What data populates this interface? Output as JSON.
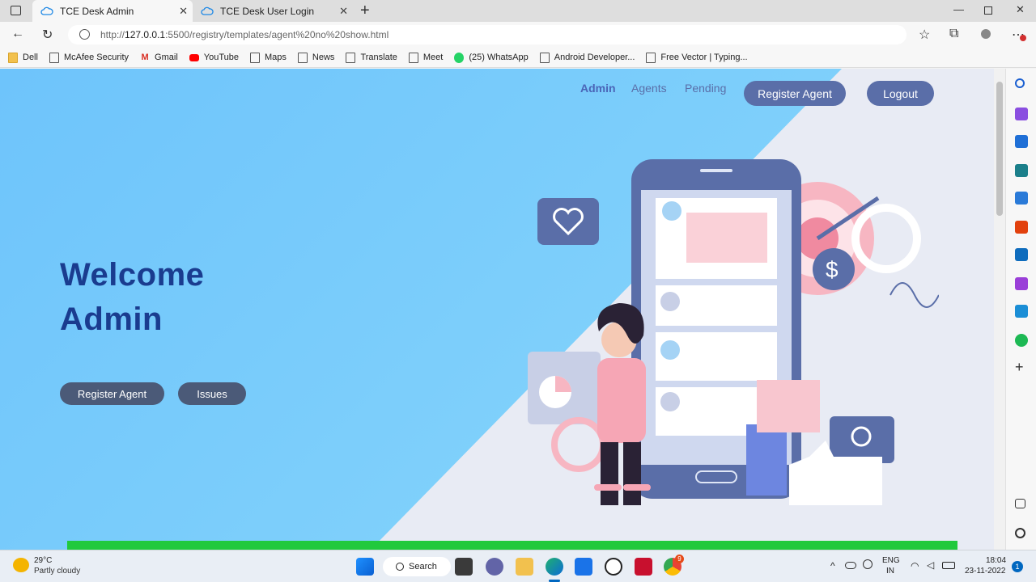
{
  "browser": {
    "tabs": [
      {
        "title": "TCE Desk Admin",
        "active": true
      },
      {
        "title": "TCE Desk User Login",
        "active": false
      }
    ],
    "url_prefix": "http://",
    "url_host": "127.0.0.1",
    "url_rest": ":5500/registry/templates/agent%20no%20show.html",
    "bookmarks": [
      {
        "label": "Dell",
        "icon": "folder-icon"
      },
      {
        "label": "McAfee Security",
        "icon": "page-icon"
      },
      {
        "label": "Gmail",
        "icon": "gmail-icon"
      },
      {
        "label": "YouTube",
        "icon": "youtube-icon"
      },
      {
        "label": "Maps",
        "icon": "page-icon"
      },
      {
        "label": "News",
        "icon": "page-icon"
      },
      {
        "label": "Translate",
        "icon": "page-icon"
      },
      {
        "label": "Meet",
        "icon": "page-icon"
      },
      {
        "label": "(25) WhatsApp",
        "icon": "whatsapp-icon"
      },
      {
        "label": "Android Developer...",
        "icon": "page-icon"
      },
      {
        "label": "Free Vector | Typing...",
        "icon": "page-icon"
      }
    ]
  },
  "page": {
    "nav": {
      "admin": "Admin",
      "agents": "Agents",
      "pending": "Pending",
      "register_agent": "Register Agent",
      "logout": "Logout"
    },
    "hero": {
      "line1": "Welcome",
      "line2": "Admin",
      "btn_register": "Register Agent",
      "btn_issues": "Issues"
    },
    "colors": {
      "accent": "#5a6ea8",
      "heading": "#1a3c8f",
      "green_bar": "#21c93c"
    }
  },
  "taskbar": {
    "weather_temp": "29°C",
    "weather_desc": "Partly cloudy",
    "search": "Search",
    "lang_top": "ENG",
    "lang_bottom": "IN",
    "time": "18:04",
    "date": "23-11-2022",
    "notif_count": "1",
    "chrome_badge": "9"
  }
}
